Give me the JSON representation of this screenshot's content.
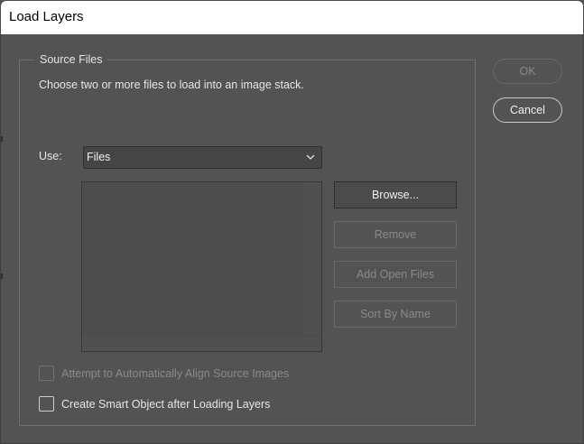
{
  "window": {
    "title": "Load Layers"
  },
  "source_files": {
    "legend": "Source Files",
    "description": "Choose two or more files to load into an image stack.",
    "use_label": "Use:",
    "use_value": "Files",
    "buttons": {
      "browse": "Browse...",
      "remove": "Remove",
      "add_open_files": "Add Open Files",
      "sort_by_name": "Sort By Name"
    },
    "files": []
  },
  "options": {
    "align_label": "Attempt to Automatically Align Source Images",
    "align_checked": false,
    "align_enabled": false,
    "smart_object_label": "Create Smart Object after Loading Layers",
    "smart_object_checked": false
  },
  "actions": {
    "ok": "OK",
    "cancel": "Cancel"
  }
}
